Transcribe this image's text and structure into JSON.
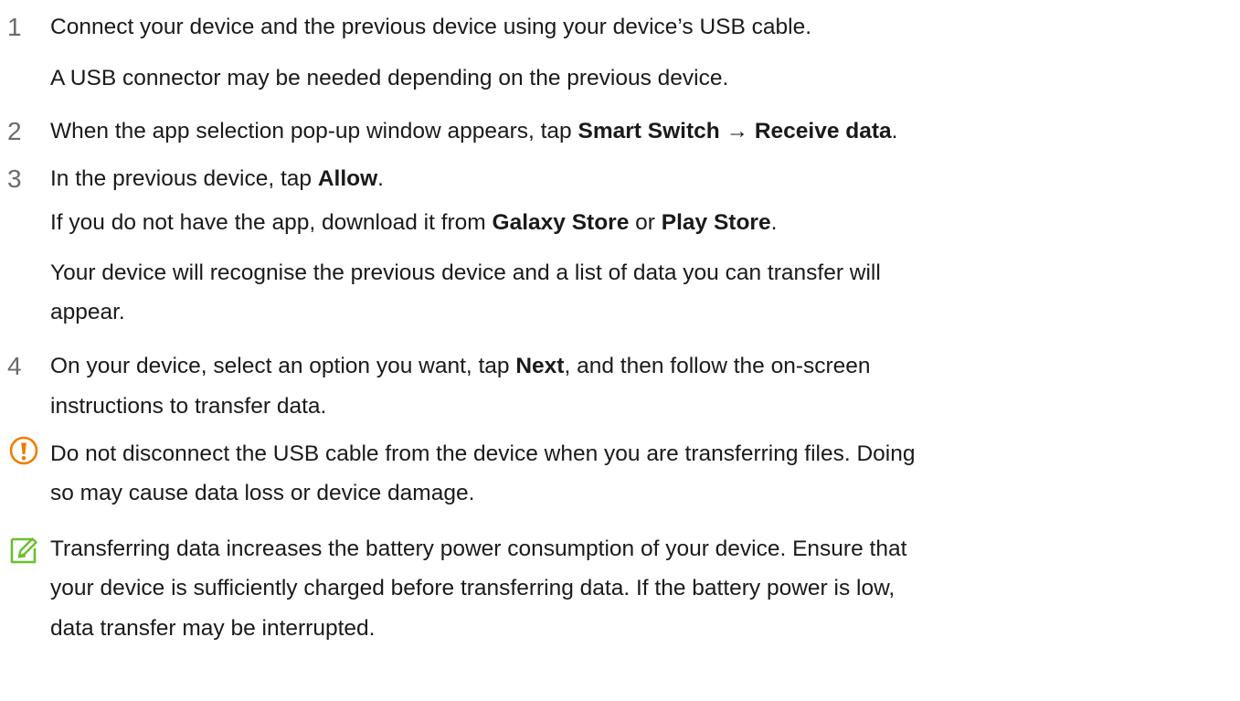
{
  "steps": [
    {
      "number": "1",
      "lines": [
        "Connect your device and the previous device using your device’s USB cable.",
        "A USB connector may be needed depending on the previous device."
      ]
    },
    {
      "number": "2",
      "lines": [
        [
          {
            "t": "When the app selection pop-up window appears, tap "
          },
          {
            "t": "Smart Switch",
            "b": true
          },
          {
            "t": " → "
          },
          {
            "t": "Receive data",
            "b": true
          },
          {
            "t": "."
          }
        ]
      ]
    },
    {
      "number": "3",
      "lines": [
        [
          {
            "t": "In the previous device, tap "
          },
          {
            "t": "Allow",
            "b": true
          },
          {
            "t": "."
          }
        ],
        [
          {
            "t": "If you do not have the app, download it from "
          },
          {
            "t": "Galaxy Store",
            "b": true
          },
          {
            "t": " or "
          },
          {
            "t": "Play Store",
            "b": true
          },
          {
            "t": "."
          }
        ],
        "Your device will recognise the previous device and a list of data you can transfer will",
        "appear."
      ]
    },
    {
      "number": "4",
      "lines": [
        [
          {
            "t": "On your device, select an option you want, tap "
          },
          {
            "t": "Next",
            "b": true
          },
          {
            "t": ", and then follow the on-screen"
          }
        ],
        "instructions to transfer data."
      ]
    }
  ],
  "caution": {
    "icon": "caution-icon",
    "color": "#f07d00",
    "lines": [
      "Do not disconnect the USB cable from the device when you are transferring files. Doing",
      "so may cause data loss or device damage."
    ]
  },
  "note": {
    "icon": "note-icon",
    "color": "#6cbf2f",
    "lines": [
      "Transferring data increases the battery power consumption of your device. Ensure that",
      "your device is sufficiently charged before transferring data. If the battery power is low,",
      "data transfer may be interrupted."
    ]
  }
}
